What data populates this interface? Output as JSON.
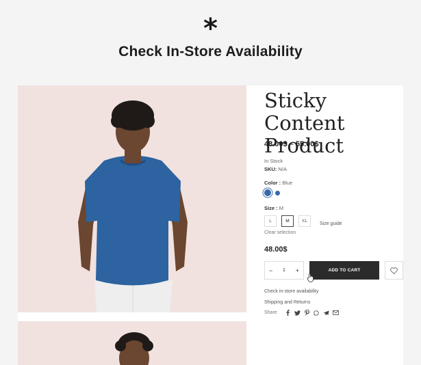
{
  "header": {
    "icon": "asterisk-icon",
    "asterisk": "*",
    "title": "Check In-Store Availability"
  },
  "product": {
    "title": "Sticky Content Product",
    "price_range": "48.00$ – 55.00$",
    "stock": "In Stock",
    "sku_label": "SKU:",
    "sku_value": "N/A",
    "color_label": "Color :",
    "color_value": "Blue",
    "swatches": [
      "#3568a8",
      "#3568a8"
    ],
    "size_label": "Size :",
    "size_value": "M",
    "sizes": [
      "L",
      "M",
      "XL"
    ],
    "size_guide": "Size guide",
    "clear_selection": "Clear selection",
    "price": "48.00$",
    "quantity": "1",
    "minus": "−",
    "plus": "+",
    "add_to_cart": "ADD TO CART",
    "check_store": "Check in-store availability",
    "shipping": "Shipping and Returns",
    "share_label": "Share",
    "share_icons": [
      "facebook-icon",
      "twitter-icon",
      "pinterest-icon",
      "whatsapp-icon",
      "telegram-icon",
      "email-icon"
    ]
  }
}
